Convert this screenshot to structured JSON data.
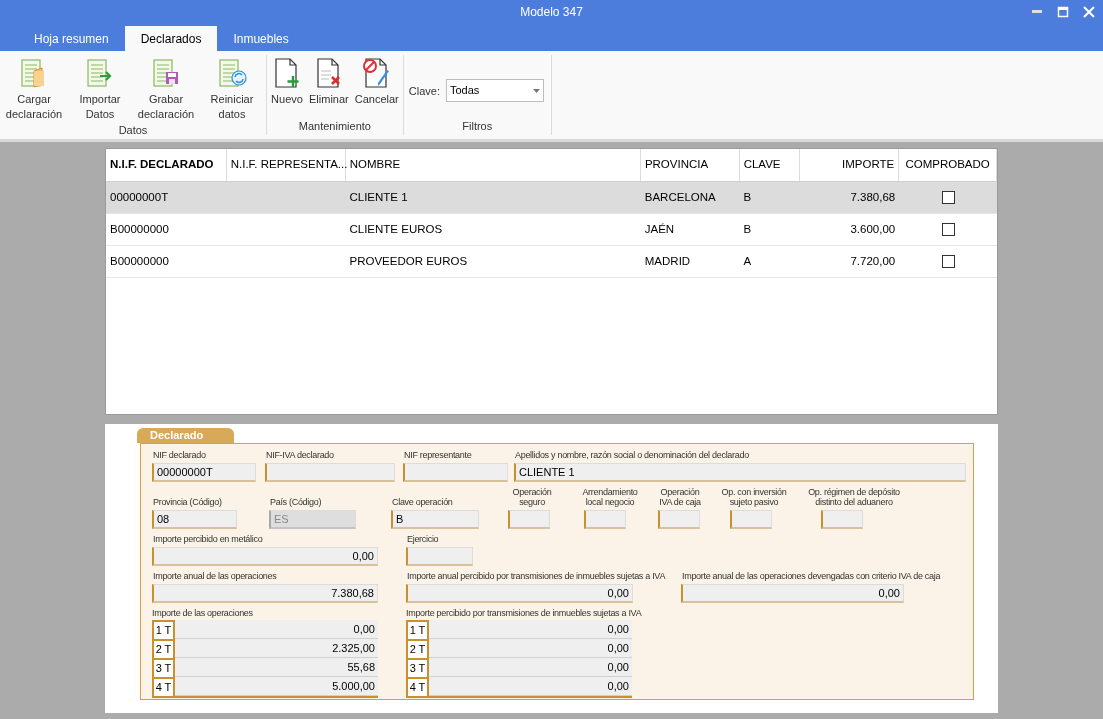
{
  "window": {
    "title": "Modelo 347"
  },
  "tabs": [
    {
      "label": "Hoja resumen",
      "selected": false
    },
    {
      "label": "Declarados",
      "selected": true
    },
    {
      "label": "Inmuebles",
      "selected": false
    }
  ],
  "ribbon": {
    "groups": [
      {
        "label": "Datos",
        "items": [
          {
            "kind": "load",
            "label": "Cargar declaración"
          },
          {
            "kind": "import",
            "label": "Importar Datos"
          },
          {
            "kind": "save",
            "label": "Grabar declaración"
          },
          {
            "kind": "reset",
            "label": "Reiniciar datos"
          }
        ]
      },
      {
        "label": "Mantenimiento",
        "items": [
          {
            "kind": "new",
            "label": "Nuevo"
          },
          {
            "kind": "delete",
            "label": "Eliminar"
          },
          {
            "kind": "cancel",
            "label": "Cancelar"
          }
        ]
      }
    ],
    "filter": {
      "group": "Filtros",
      "label": "Clave:",
      "value": "Todas"
    }
  },
  "table": {
    "columns": [
      "N.I.F. DECLARADO",
      "N.I.F. REPRESENTA...",
      "NOMBRE",
      "PROVINCIA",
      "CLAVE",
      "IMPORTE",
      "COMPROBADO"
    ],
    "rows": [
      {
        "selected": true,
        "checked": false,
        "cells": [
          "00000000T",
          "",
          "CLIENTE 1",
          "BARCELONA",
          "B",
          "7.380,68"
        ]
      },
      {
        "selected": false,
        "checked": false,
        "cells": [
          "B00000000",
          "",
          "CLIENTE EUROS",
          "JAÉN",
          "B",
          "3.600,00"
        ]
      },
      {
        "selected": false,
        "checked": false,
        "cells": [
          "B00000000",
          "",
          "PROVEEDOR EUROS",
          "MADRID",
          "A",
          "7.720,00"
        ]
      }
    ]
  },
  "form": {
    "tab": "Declarado",
    "fields": [
      {
        "label": "NIF declarado",
        "value": "00000000T",
        "disabled": false
      },
      {
        "label": "NIF-IVA declarado",
        "disabled": false
      },
      {
        "label": "NIF representante",
        "disabled": false
      },
      {
        "label": "Apellidos y nombre, razón social o denominación del declarado",
        "value": "CLIENTE 1",
        "disabled": false
      },
      {
        "label": "Provincia (Código)",
        "value": "08",
        "disabled": false
      },
      {
        "label": "País (Código)",
        "value": "ES",
        "disabled": true
      },
      {
        "label": "Clave operación",
        "value": "B",
        "disabled": false
      },
      {
        "label": "Operación seguro",
        "disabled": false
      },
      {
        "label": "Arrendamiento local negocio",
        "disabled": false
      },
      {
        "label": "Operación IVA de caja",
        "disabled": false
      },
      {
        "label": "Op. con inversión sujeto pasivo",
        "disabled": false
      },
      {
        "label": "Op. régimen de depósito distinto del aduanero",
        "disabled": false
      },
      {
        "label": "Importe percibido en metálico",
        "value": "0,00",
        "disabled": false
      },
      {
        "label": "Ejercicio",
        "disabled": false
      },
      {
        "label": "Importe anual de las operaciones",
        "value": "7.380,68",
        "disabled": false
      },
      {
        "label": "Importe anual percibido por transmisiones de inmuebles sujetas a IVA",
        "value": "0,00",
        "disabled": false
      },
      {
        "label": "Importe anual de las operaciones devengadas con criterio IVA de caja",
        "value": "0,00",
        "disabled": false
      }
    ],
    "quarters": [
      {
        "label": "Importe de las operaciones",
        "rows": [
          {
            "q": "1 T",
            "value": "0,00"
          },
          {
            "q": "2 T",
            "value": "2.325,00"
          },
          {
            "q": "3 T",
            "value": "55,68"
          },
          {
            "q": "4 T",
            "value": "5.000,00"
          }
        ]
      },
      {
        "label": "Importe percibido por transmisiones de inmuebles sujetas a IVA",
        "rows": [
          {
            "q": "1 T",
            "value": "0,00"
          },
          {
            "q": "2 T",
            "value": "0,00"
          },
          {
            "q": "3 T",
            "value": "0,00"
          },
          {
            "q": "4 T",
            "value": "0,00"
          }
        ]
      }
    ]
  }
}
